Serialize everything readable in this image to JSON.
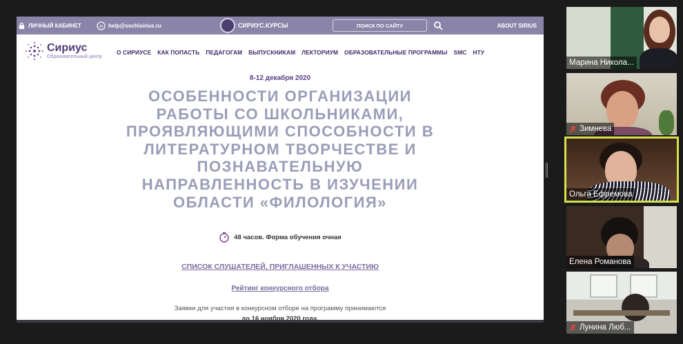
{
  "screen": {
    "topbar": {
      "cabinet": "ЛИЧНЫЙ КАБИНЕТ",
      "email": "help@sochisirius.ru",
      "brand": "СИРИУС.КУРСЫ",
      "search": "ПОИСК ПО САЙТУ",
      "about": "ABOUT SIRIUS"
    },
    "logo": {
      "name": "Сириус",
      "subtitle": "Образовательный центр"
    },
    "menu": [
      "О СИРИУСЕ",
      "КАК ПОПАСТЬ",
      "ПЕДАГОГАМ",
      "ВЫПУСКНИКАМ",
      "ЛЕКТОРИУМ",
      "ОБРАЗОВАТЕЛЬНЫЕ ПРОГРАММЫ",
      "SMC",
      "НТУ"
    ],
    "dates": "8-12 декабря 2020",
    "title_lines": [
      "ОСОБЕННОСТИ ОРГАНИЗАЦИИ",
      "РАБОТЫ СО ШКОЛЬНИКАМИ,",
      "ПРОЯВЛЯЮЩИМИ СПОСОБНОСТИ В",
      "ЛИТЕРАТУРНОМ ТВОРЧЕСТВЕ И",
      "ПОЗНАВАТЕЛЬНУЮ",
      "НАПРАВЛЕННОСТЬ В ИЗУЧЕНИИ",
      "ОБЛАСТИ «ФИЛОЛОГИЯ»"
    ],
    "hours": "48 часов. Форма обучения очная",
    "list_link": "СПИСОК СЛУШАТЕЛЕЙ, ПРИГЛАШЕННЫХ К УЧАСТИЮ",
    "rating_link": "Рейтинг конкурсного отбора",
    "apply_text": "Заявки для участия в конкурсном отборе на программу принимаются",
    "deadline": "до 16 ноября 2020 года."
  },
  "participants": [
    {
      "name": "Марина Никола...",
      "muted": false,
      "active": false
    },
    {
      "name": "Зимнева",
      "muted": true,
      "active": false
    },
    {
      "name": "Ольга Ефремова",
      "muted": false,
      "active": true
    },
    {
      "name": "Елена Романова",
      "muted": false,
      "active": false
    },
    {
      "name": "Лунина Люб...",
      "muted": true,
      "active": false
    }
  ],
  "colors": {
    "accent": "#4f3b79",
    "title": "#9a9db7",
    "topbar": "#8a84a8",
    "active_speaker": "#d7e24a",
    "mute": "#e0463a"
  }
}
